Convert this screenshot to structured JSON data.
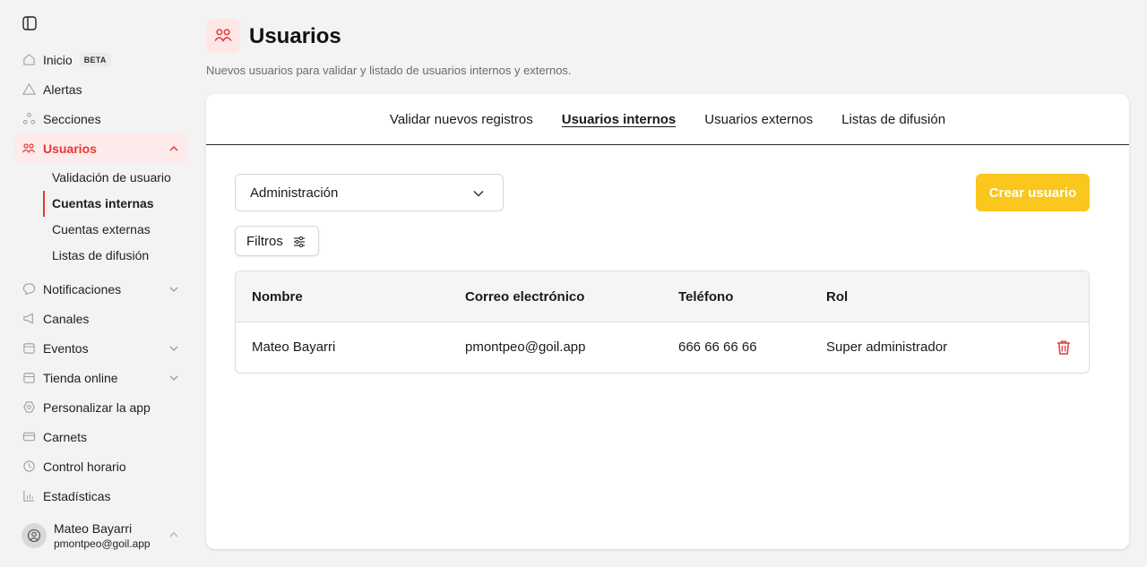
{
  "colors": {
    "accent": "#e53935",
    "accent_bg": "#fdeaea",
    "primary_button": "#fbc61d"
  },
  "sidebar": {
    "toggle_icon": "sidebar-toggle-icon",
    "items": [
      {
        "label": "Inicio",
        "icon": "home-icon",
        "badge": "BETA"
      },
      {
        "label": "Alertas",
        "icon": "alert-icon"
      },
      {
        "label": "Secciones",
        "icon": "sections-icon"
      },
      {
        "label": "Usuarios",
        "icon": "users-icon",
        "active": true,
        "expanded": true
      },
      {
        "label": "Notificaciones",
        "icon": "chat-icon",
        "expandable": true
      },
      {
        "label": "Canales",
        "icon": "megaphone-icon"
      },
      {
        "label": "Eventos",
        "icon": "calendar-icon",
        "expandable": true
      },
      {
        "label": "Tienda online",
        "icon": "store-icon",
        "expandable": true
      },
      {
        "label": "Personalizar la app",
        "icon": "gear-icon"
      },
      {
        "label": "Carnets",
        "icon": "card-icon"
      },
      {
        "label": "Control horario",
        "icon": "clock-icon"
      },
      {
        "label": "Estadísticas",
        "icon": "chart-icon"
      }
    ],
    "sub_items": [
      {
        "label": "Validación de usuario"
      },
      {
        "label": "Cuentas internas",
        "active": true
      },
      {
        "label": "Cuentas externas"
      },
      {
        "label": "Listas de difusión"
      }
    ],
    "user": {
      "name": "Mateo Bayarri",
      "email": "pmontpeo@goil.app"
    }
  },
  "header": {
    "title": "Usuarios",
    "subtitle": "Nuevos usuarios para validar y listado de usuarios internos y externos."
  },
  "tabs": [
    {
      "label": "Validar nuevos registros"
    },
    {
      "label": "Usuarios internos",
      "active": true
    },
    {
      "label": "Usuarios externos"
    },
    {
      "label": "Listas de difusión"
    }
  ],
  "controls": {
    "select_value": "Administración",
    "create_button": "Crear usuario",
    "filters_button": "Filtros"
  },
  "table": {
    "columns": [
      "Nombre",
      "Correo electrónico",
      "Teléfono",
      "Rol"
    ],
    "rows": [
      {
        "name": "Mateo Bayarri",
        "email": "pmontpeo@goil.app",
        "phone": "666 66 66 66",
        "role": "Super administrador"
      }
    ]
  }
}
